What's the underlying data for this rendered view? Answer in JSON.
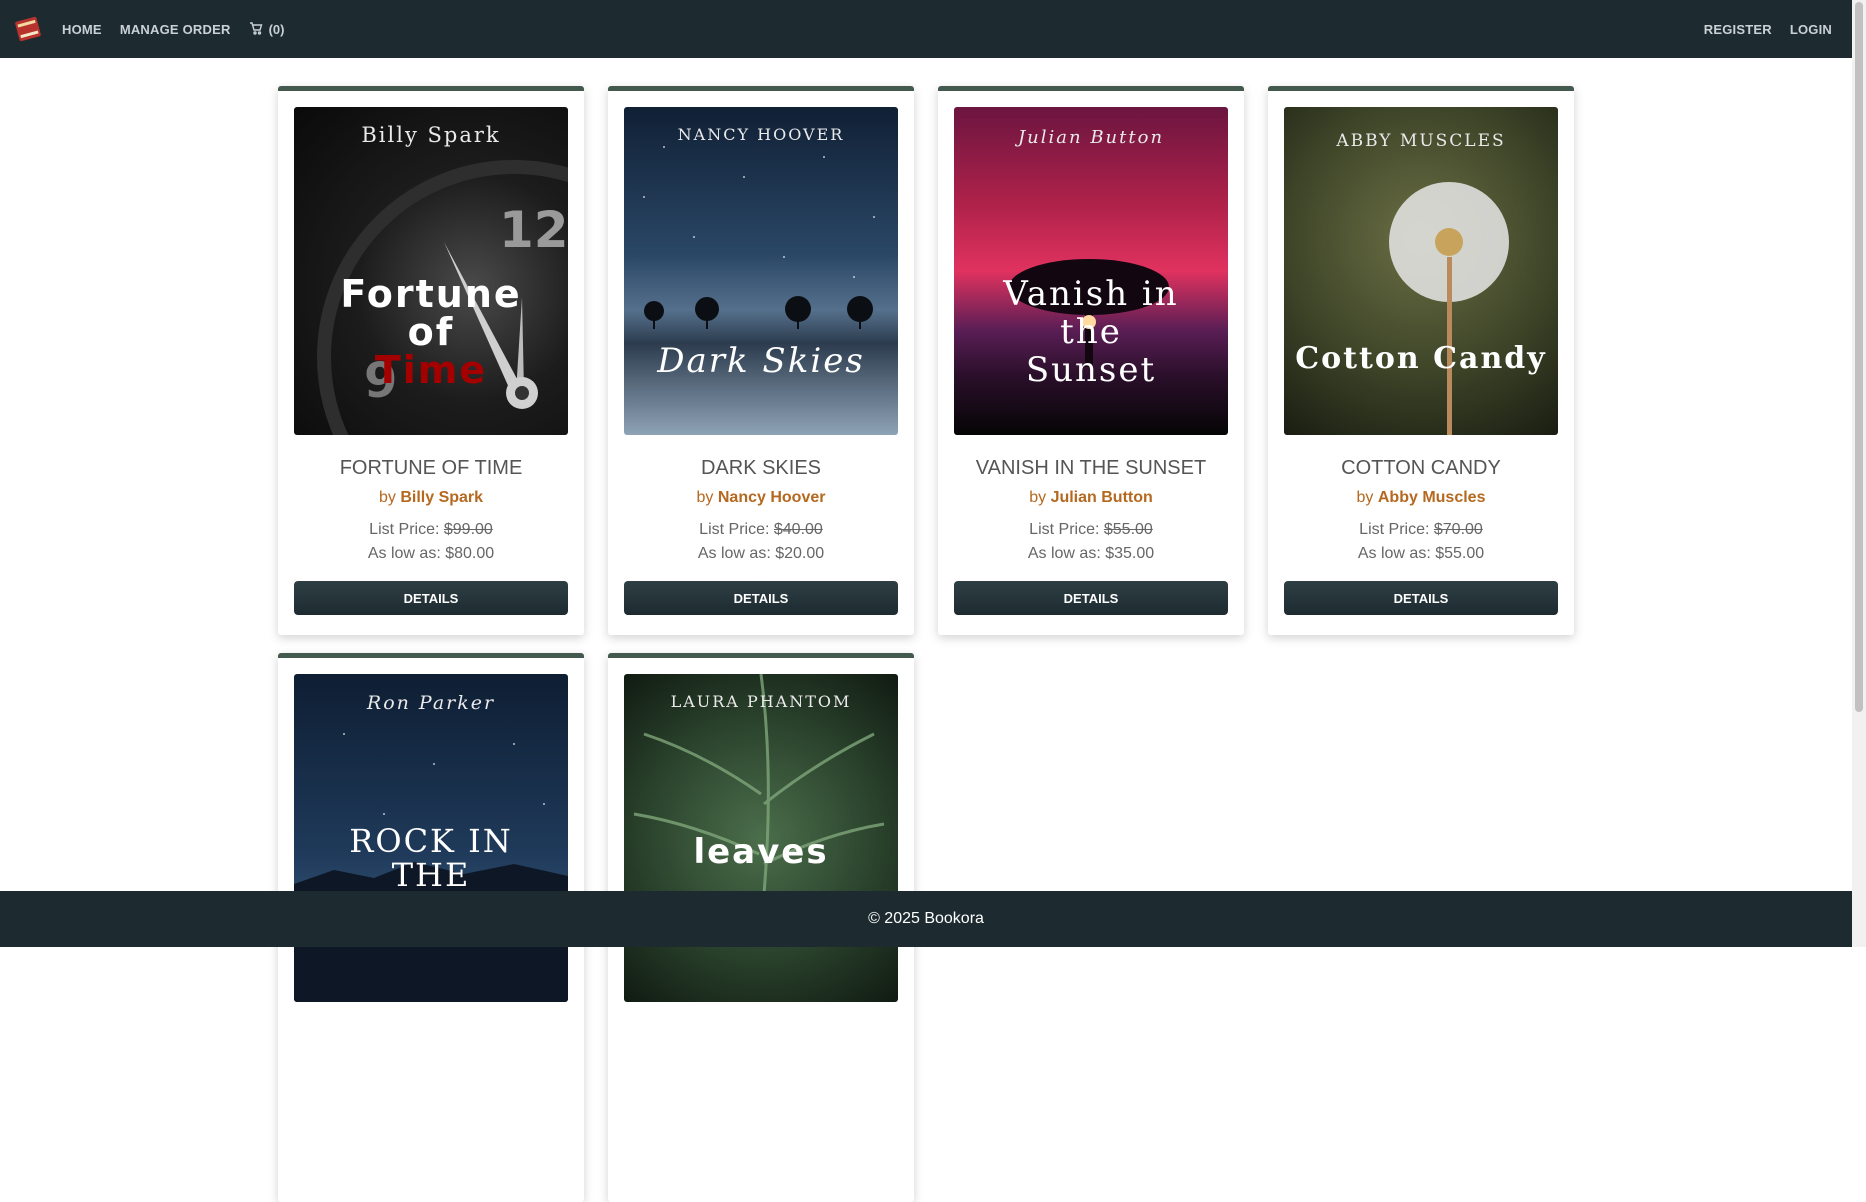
{
  "nav": {
    "home": "HOME",
    "manage_order": "MANAGE ORDER",
    "cart_count": "(0)",
    "register": "REGISTER",
    "login": "LOGIN"
  },
  "books": [
    {
      "cover_author": "Billy Spark",
      "cover_title_line1": "Fortune",
      "cover_title_line2": "of",
      "cover_title_line3": "Time",
      "title": "FORTUNE OF TIME",
      "by": "by",
      "author": "Billy Spark",
      "list_label": "List Price:",
      "list_price": "$99.00",
      "low_label": "As low as:",
      "low_price": "$80.00",
      "details": "DETAILS"
    },
    {
      "cover_author": "NANCY HOOVER",
      "cover_title_line1": "Dark Skies",
      "title": "DARK SKIES",
      "by": "by",
      "author": "Nancy Hoover",
      "list_label": "List Price:",
      "list_price": "$40.00",
      "low_label": "As low as:",
      "low_price": "$20.00",
      "details": "DETAILS"
    },
    {
      "cover_author": "Julian Button",
      "cover_title_line1": "Vanish in",
      "cover_title_line2": "the",
      "cover_title_line3": "Sunset",
      "title": "VANISH IN THE SUNSET",
      "by": "by",
      "author": "Julian Button",
      "list_label": "List Price:",
      "list_price": "$55.00",
      "low_label": "As low as:",
      "low_price": "$35.00",
      "details": "DETAILS"
    },
    {
      "cover_author": "ABBY MUSCLES",
      "cover_title_line1": "Cotton Candy",
      "title": "COTTON CANDY",
      "by": "by",
      "author": "Abby Muscles",
      "list_label": "List Price:",
      "list_price": "$70.00",
      "low_label": "As low as:",
      "low_price": "$55.00",
      "details": "DETAILS"
    },
    {
      "cover_author": "Ron Parker",
      "cover_title_line1": "ROCK IN",
      "cover_title_line2": "THE"
    },
    {
      "cover_author": "LAURA PHANTOM",
      "cover_title_line1": "leaves"
    }
  ],
  "footer": {
    "text": "© 2025 Bookora"
  }
}
